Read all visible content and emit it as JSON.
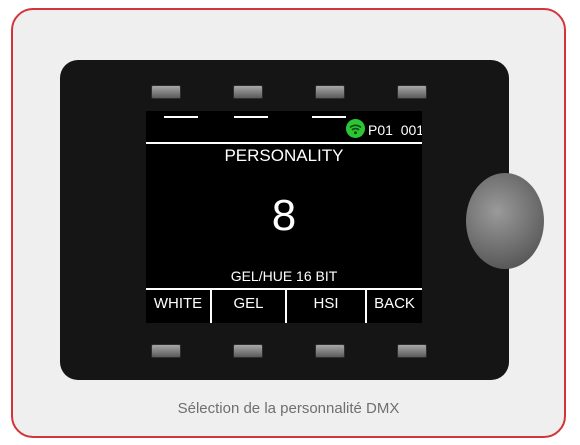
{
  "screen": {
    "status": "P01  001",
    "title": "PERSONALITY",
    "value": "8",
    "mode": "GEL/HUE 16 BIT",
    "softkeys": [
      "WHITE",
      "GEL",
      "HSI",
      "BACK"
    ],
    "wifi_color": "#2ec535"
  },
  "caption": "Sélection de la personnalité DMX",
  "colors": {
    "frame_border": "#d3333a",
    "device_body": "#151515"
  }
}
